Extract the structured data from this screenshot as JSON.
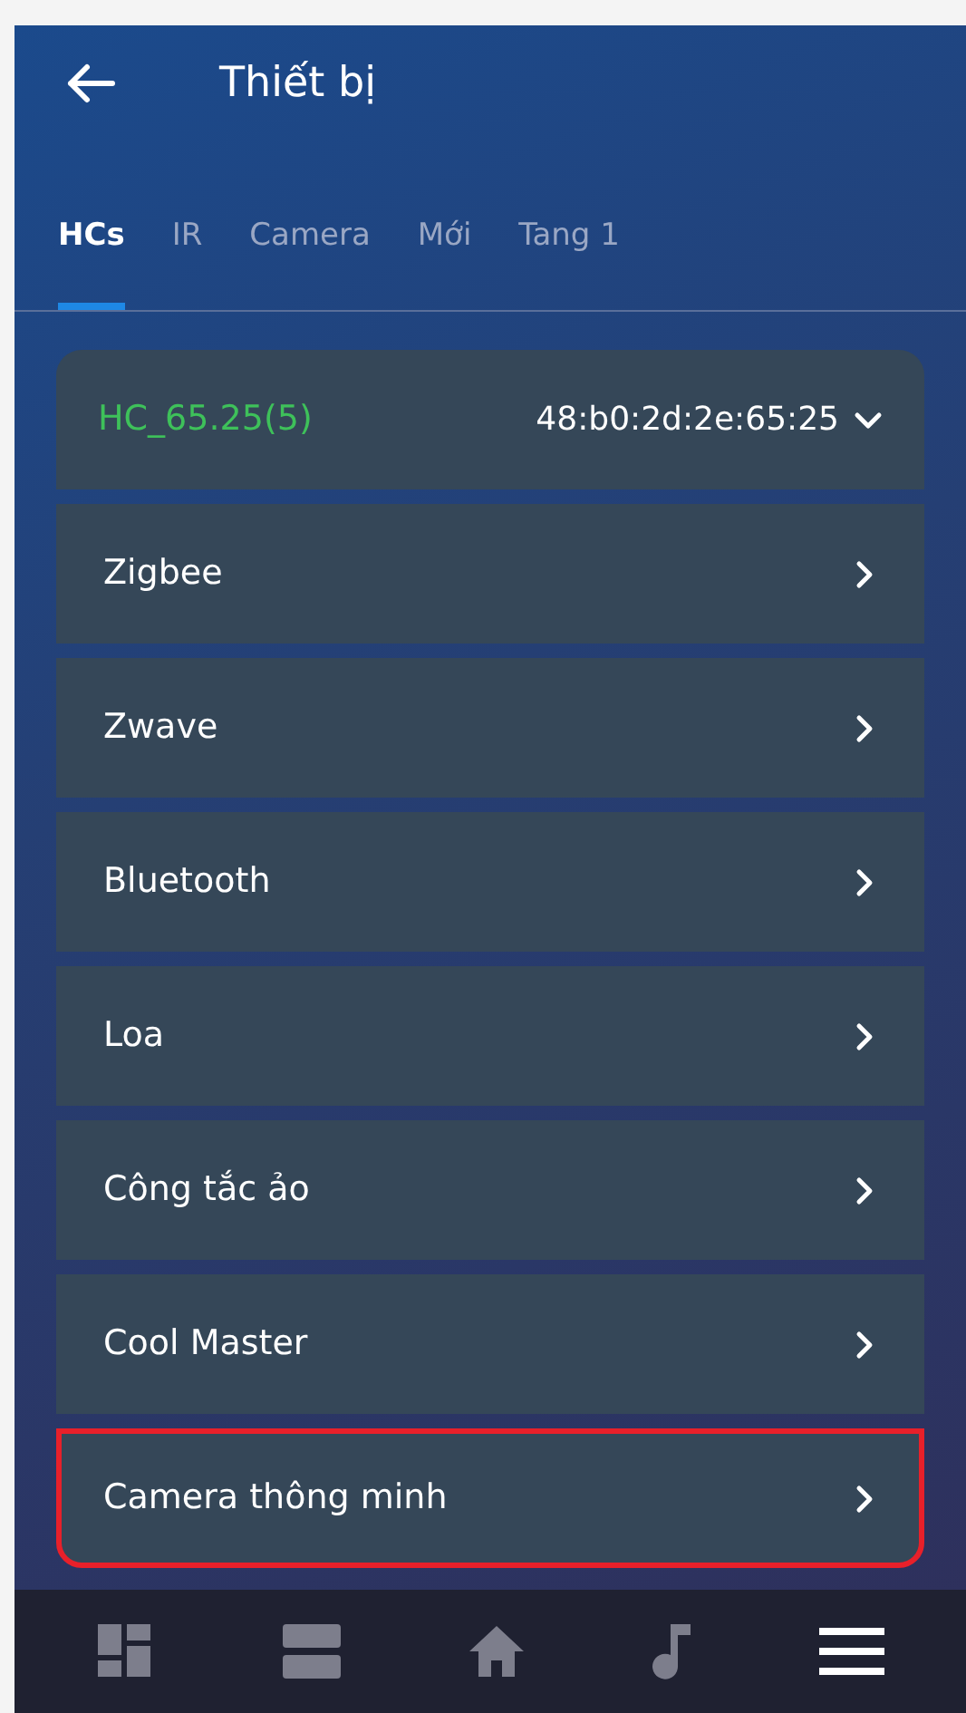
{
  "header": {
    "title": "Thiết bị"
  },
  "tabs": [
    {
      "label": "HCs",
      "selected": true
    },
    {
      "label": "IR",
      "selected": false
    },
    {
      "label": "Camera",
      "selected": false
    },
    {
      "label": "Mới",
      "selected": false
    },
    {
      "label": "Tang 1",
      "selected": false
    }
  ],
  "hub": {
    "name": "HC_65.25(5)",
    "address": "48:b0:2d:2e:65:25"
  },
  "items": [
    {
      "label": "Zigbee",
      "highlighted": false
    },
    {
      "label": "Zwave",
      "highlighted": false
    },
    {
      "label": "Bluetooth",
      "highlighted": false
    },
    {
      "label": "Loa",
      "highlighted": false
    },
    {
      "label": "Công tắc ảo",
      "highlighted": false
    },
    {
      "label": "Cool Master",
      "highlighted": false
    },
    {
      "label": "Camera thông minh",
      "highlighted": true
    }
  ],
  "nav": [
    {
      "kind": "dashboard",
      "selected": false
    },
    {
      "kind": "rooms",
      "selected": false
    },
    {
      "kind": "home",
      "selected": false
    },
    {
      "kind": "music",
      "selected": false
    },
    {
      "kind": "menu",
      "selected": true
    }
  ]
}
